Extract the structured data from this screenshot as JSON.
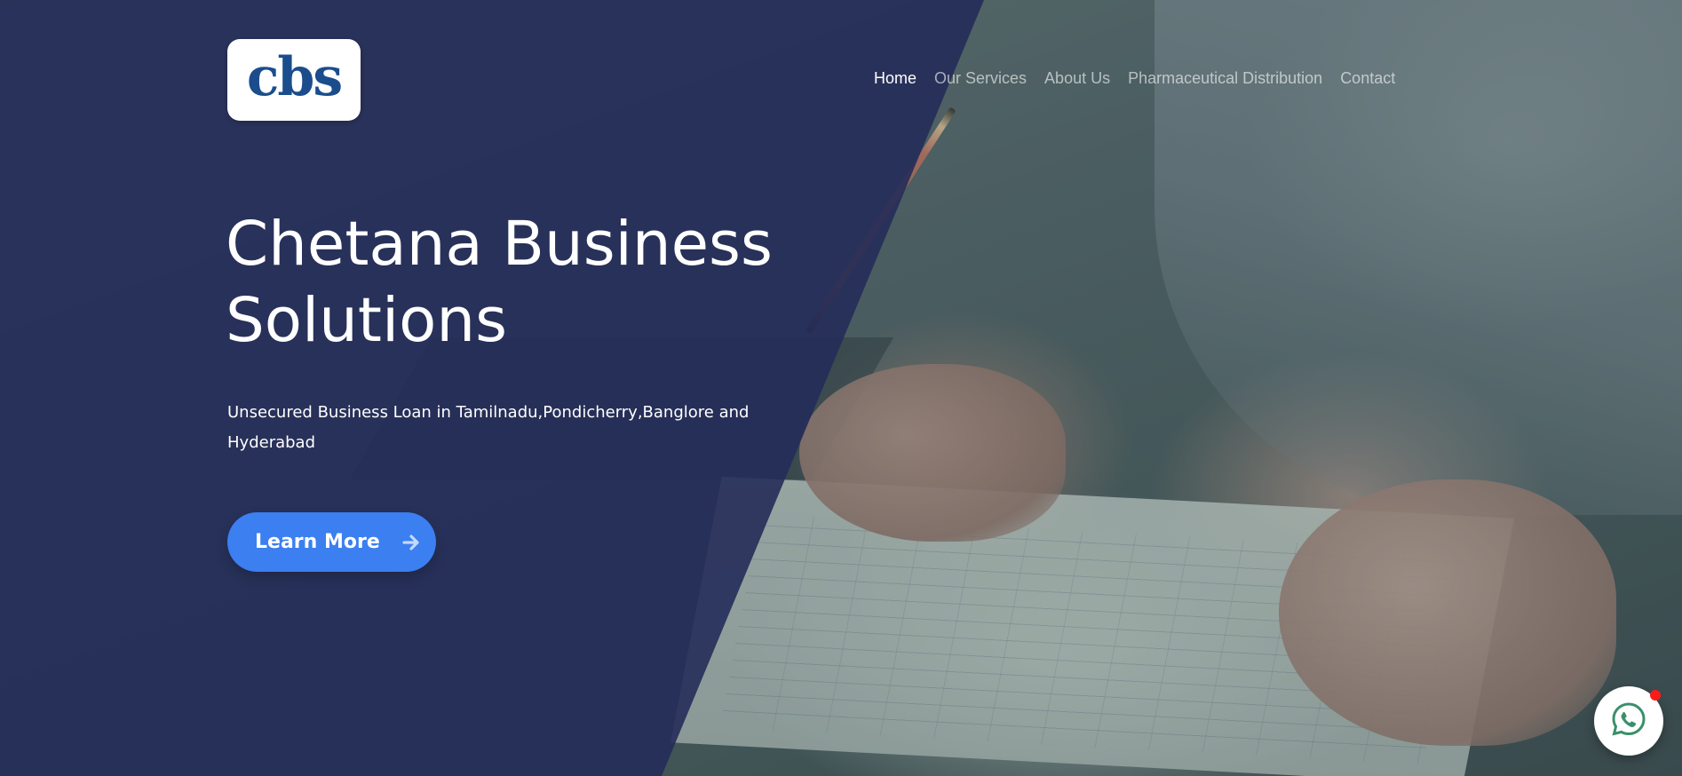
{
  "brand": {
    "logo_text": "cbs",
    "logo_color": "#1b4d8c"
  },
  "nav": {
    "items": [
      {
        "label": "Home",
        "active": true
      },
      {
        "label": "Our Services",
        "active": false
      },
      {
        "label": "About Us",
        "active": false
      },
      {
        "label": "Pharmaceutical Distribution",
        "active": false
      },
      {
        "label": "Contact",
        "active": false
      }
    ]
  },
  "hero": {
    "title_line1": "Chetana Business",
    "title_line2": "Solutions",
    "subtitle": "Unsecured Business Loan in Tamilnadu,Pondicherry,Banglore and Hyderabad",
    "cta_label": "Learn More",
    "cta_icon": "arrow-right-icon",
    "cta_color": "#3b7ff0"
  },
  "floating": {
    "whatsapp_icon": "whatsapp-icon",
    "notification_color": "#ff1a1a"
  },
  "colors": {
    "overlay": "#242c58",
    "text": "#ffffff"
  }
}
